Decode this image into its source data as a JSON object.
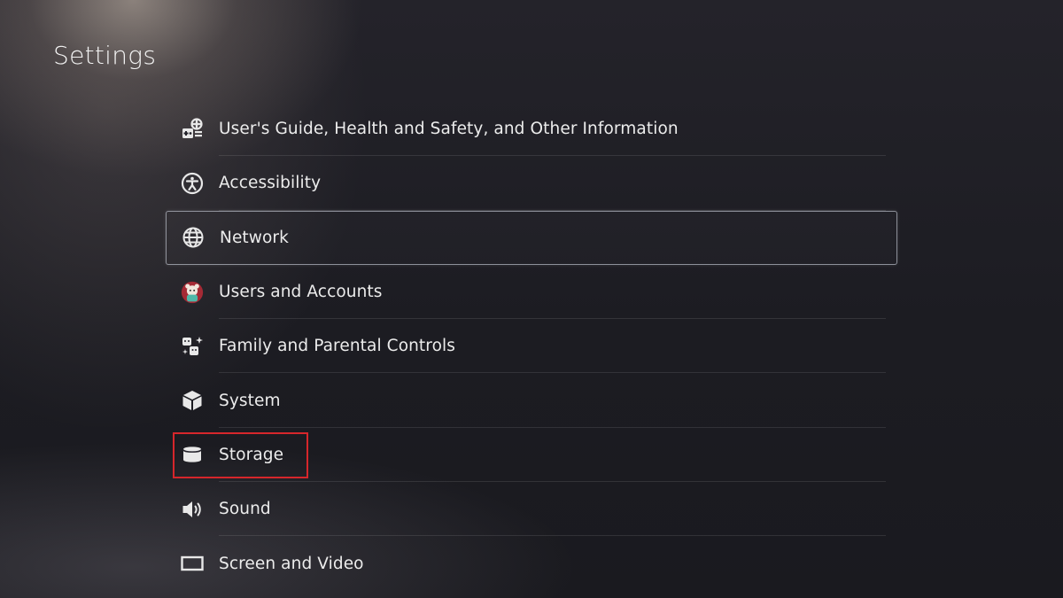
{
  "page": {
    "title": "Settings"
  },
  "menu": {
    "items": [
      {
        "label": "User's Guide, Health and Safety, and Other Information",
        "icon": "guide-icon"
      },
      {
        "label": "Accessibility",
        "icon": "accessibility-icon"
      },
      {
        "label": "Network",
        "icon": "globe-icon"
      },
      {
        "label": "Users and Accounts",
        "icon": "user-avatar-icon"
      },
      {
        "label": "Family and Parental Controls",
        "icon": "family-icon"
      },
      {
        "label": "System",
        "icon": "cube-icon"
      },
      {
        "label": "Storage",
        "icon": "storage-icon"
      },
      {
        "label": "Sound",
        "icon": "speaker-icon"
      },
      {
        "label": "Screen and Video",
        "icon": "screen-icon"
      }
    ],
    "focused_item": "Network"
  },
  "annotation": {
    "highlight_color": "#d6262b",
    "highlighted_item": "Storage"
  }
}
